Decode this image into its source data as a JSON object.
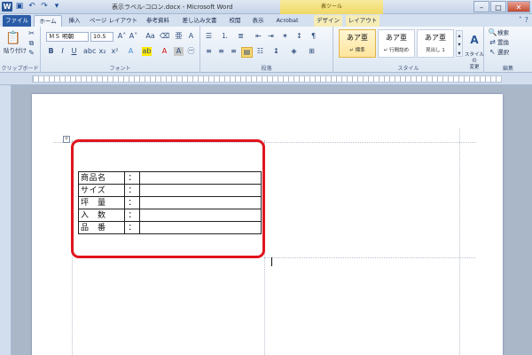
{
  "titlebar": {
    "title": "表示ラベル-コロン.docx - Microsoft Word",
    "table_tools": "表ツール",
    "controls": {
      "minimize": "–",
      "maximize": "□",
      "close": "✕"
    }
  },
  "tabs": [
    {
      "label": "ファイル"
    },
    {
      "label": "ホーム"
    },
    {
      "label": "挿入"
    },
    {
      "label": "ページ レイアウト"
    },
    {
      "label": "参考資料"
    },
    {
      "label": "差し込み文書"
    },
    {
      "label": "校閲"
    },
    {
      "label": "表示"
    },
    {
      "label": "Acrobat"
    },
    {
      "label": "デザイン"
    },
    {
      "label": "レイアウト"
    }
  ],
  "ribbon": {
    "clipboard": {
      "paste": "貼り付け",
      "label": "クリップボード"
    },
    "font": {
      "name": "ＭＳ 明朝",
      "size": "10.5",
      "label": "フォント"
    },
    "paragraph": {
      "label": "段落"
    },
    "styles": {
      "items": [
        {
          "sample": "あア亜",
          "name": "↵ 標準"
        },
        {
          "sample": "あア亜",
          "name": "↵ 行間詰め"
        },
        {
          "sample": "あア亜",
          "name": "見出し 1"
        }
      ],
      "change_styles": "スタイルの\n変更",
      "label": "スタイル"
    },
    "editing": {
      "find": "検索",
      "replace": "置換",
      "select": "選択",
      "label": "編集"
    }
  },
  "document": {
    "table": [
      {
        "label": "商品名",
        "colon": "：",
        "value": ""
      },
      {
        "label": "サイズ",
        "colon": "：",
        "value": ""
      },
      {
        "label": "坪　量",
        "colon": "：",
        "value": ""
      },
      {
        "label": "入　数",
        "colon": "：",
        "value": ""
      },
      {
        "label": "品　番",
        "colon": "：",
        "value": ""
      }
    ]
  },
  "colors": {
    "highlight": "#e0141e",
    "file_tab": "#2a5da8",
    "table_tools": "#f0d865"
  }
}
